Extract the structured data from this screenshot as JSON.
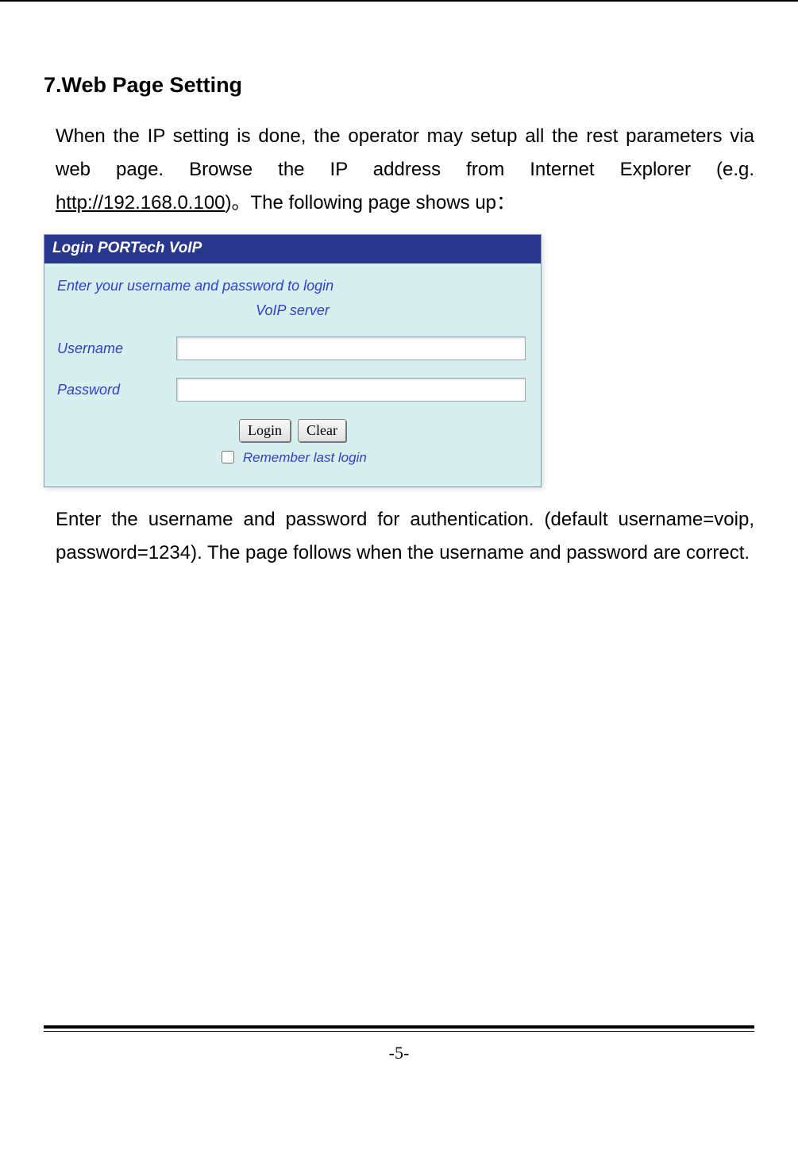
{
  "heading": "7.Web Page Setting",
  "paragraph1_part1": "When the IP setting is done, the operator may setup all the rest parameters via web page. Browse the IP address from Internet Explorer (e.g. ",
  "paragraph1_url": "http://192.168.0.100",
  "paragraph1_part2": ")。The following page shows up：",
  "login": {
    "title": "Login PORTech VoIP",
    "instruction": "Enter your username and password to login",
    "subheading": "VoIP server",
    "username_label": "Username",
    "password_label": "Password",
    "username_value": "",
    "password_value": "",
    "login_btn": "Login",
    "clear_btn": "Clear",
    "remember_label": "Remember last login"
  },
  "paragraph2": "Enter the username and password for authentication. (default username=voip, password=1234). The page follows when the username and password are correct.",
  "page_number": "-5-"
}
